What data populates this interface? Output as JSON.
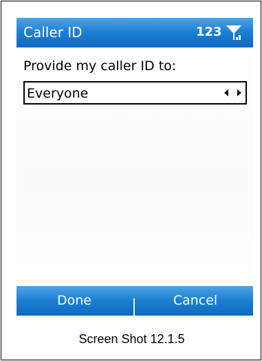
{
  "header": {
    "title": "Caller ID",
    "input_mode": "123"
  },
  "icons": {
    "signal": "signal-strength-icon",
    "picker_left": "arrow-left-icon",
    "picker_right": "arrow-right-icon"
  },
  "main": {
    "prompt": "Provide my caller ID to:",
    "picker_value": "Everyone"
  },
  "softkeys": {
    "left": "Done",
    "right": "Cancel"
  },
  "caption": "Screen Shot 12.1.5",
  "colors": {
    "bar_blue": "#1b7ed2",
    "text": "#000000",
    "bar_text": "#ffffff"
  }
}
